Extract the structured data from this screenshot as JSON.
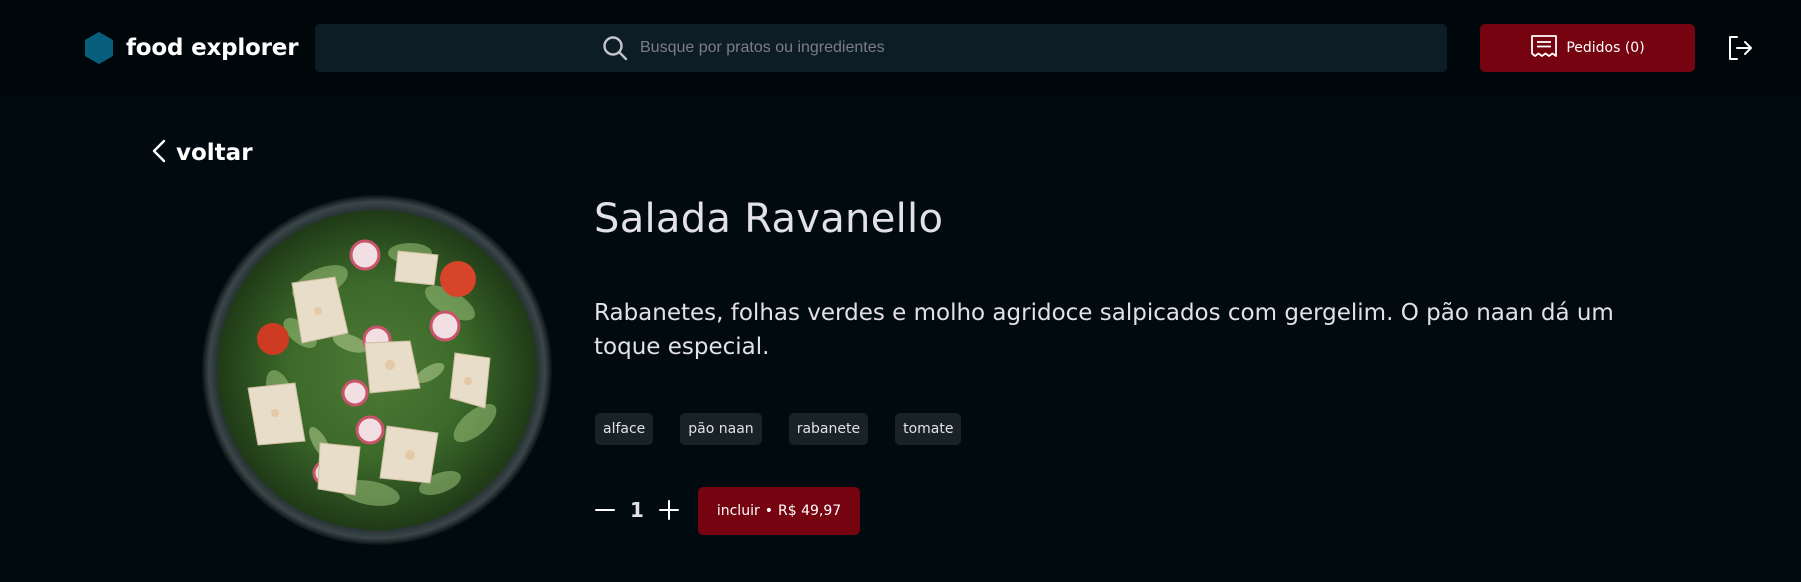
{
  "header": {
    "brand_name": "food explorer",
    "search_placeholder": "Busque por pratos ou ingredientes",
    "search_value": "",
    "orders_label": "Pedidos (0)",
    "logo_icon": "hexagon-logo-icon",
    "orders_icon": "receipt-icon",
    "logout_icon": "sign-out-icon"
  },
  "back": {
    "label": "voltar"
  },
  "dish": {
    "title": "Salada Ravanello",
    "description": "Rabanetes, folhas verdes e molho agridoce salpicados com gergelim. O pão naan dá um toque especial.",
    "ingredients": [
      "alface",
      "pão naan",
      "rabanete",
      "tomate"
    ],
    "quantity": "1",
    "add_label": "incluir",
    "separator": "•",
    "price": "R$ 49,97"
  },
  "colors": {
    "background": "#000a0f",
    "header_bg": "#00070a",
    "input_bg": "#0d1d25",
    "accent": "#750310",
    "tag_bg": "#192227",
    "logo": "#065e7c"
  }
}
